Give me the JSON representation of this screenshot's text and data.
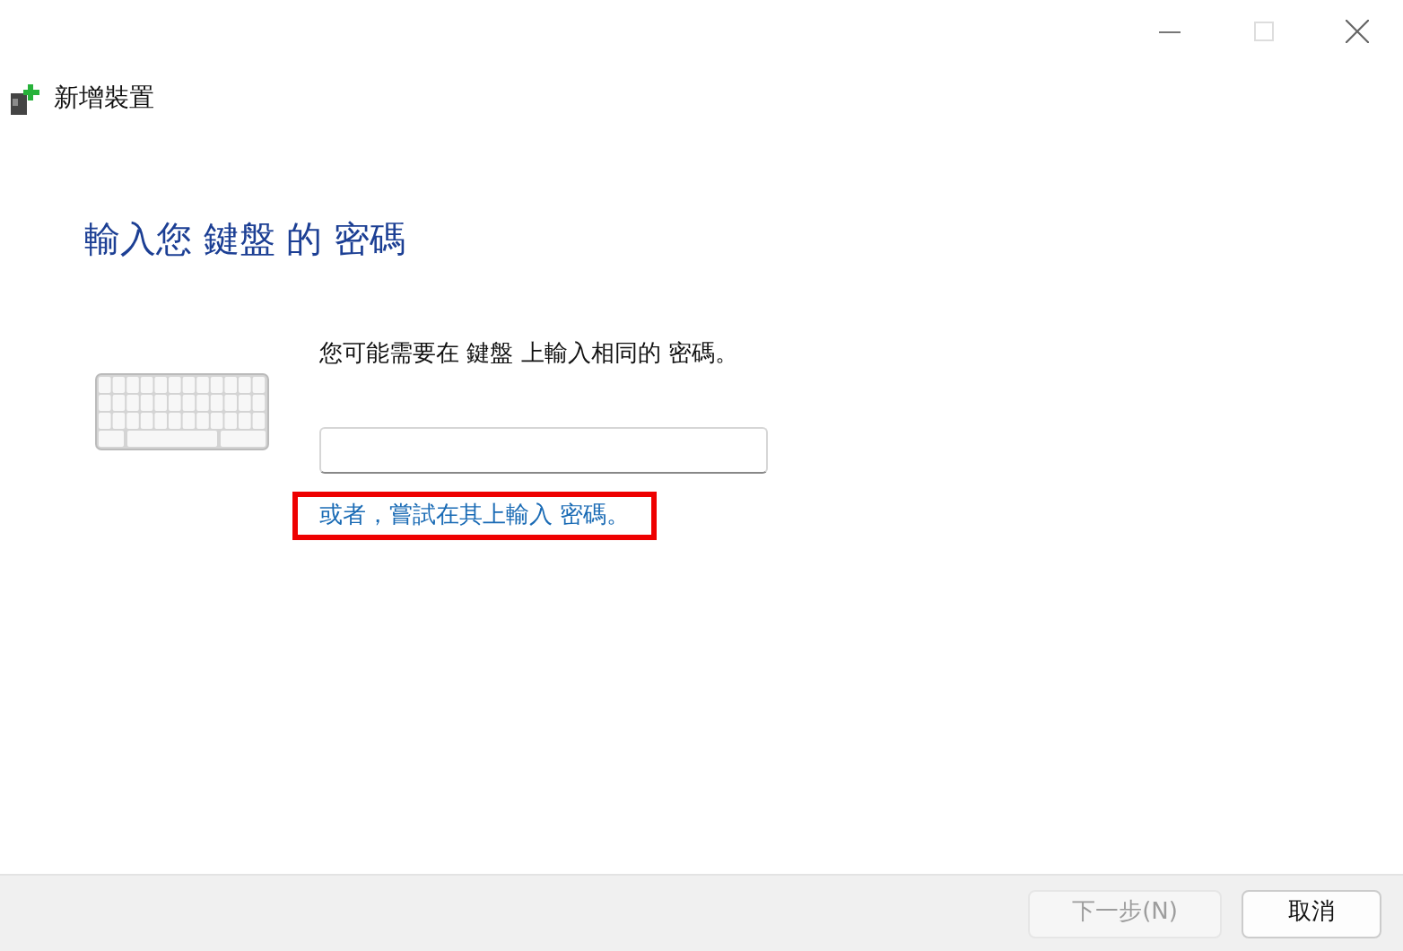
{
  "window": {
    "title": "新增裝置"
  },
  "heading": "輸入您 鍵盤 的 密碼",
  "instruction": "您可能需要在 鍵盤 上輸入相同的 密碼。",
  "alternative_link": {
    "label": "或者，嘗試在其上輸入 密碼。",
    "highlighted": true
  },
  "buttons": [
    {
      "label": "下一步(N)",
      "disabled": true
    },
    {
      "label": "取消",
      "disabled": false
    }
  ]
}
